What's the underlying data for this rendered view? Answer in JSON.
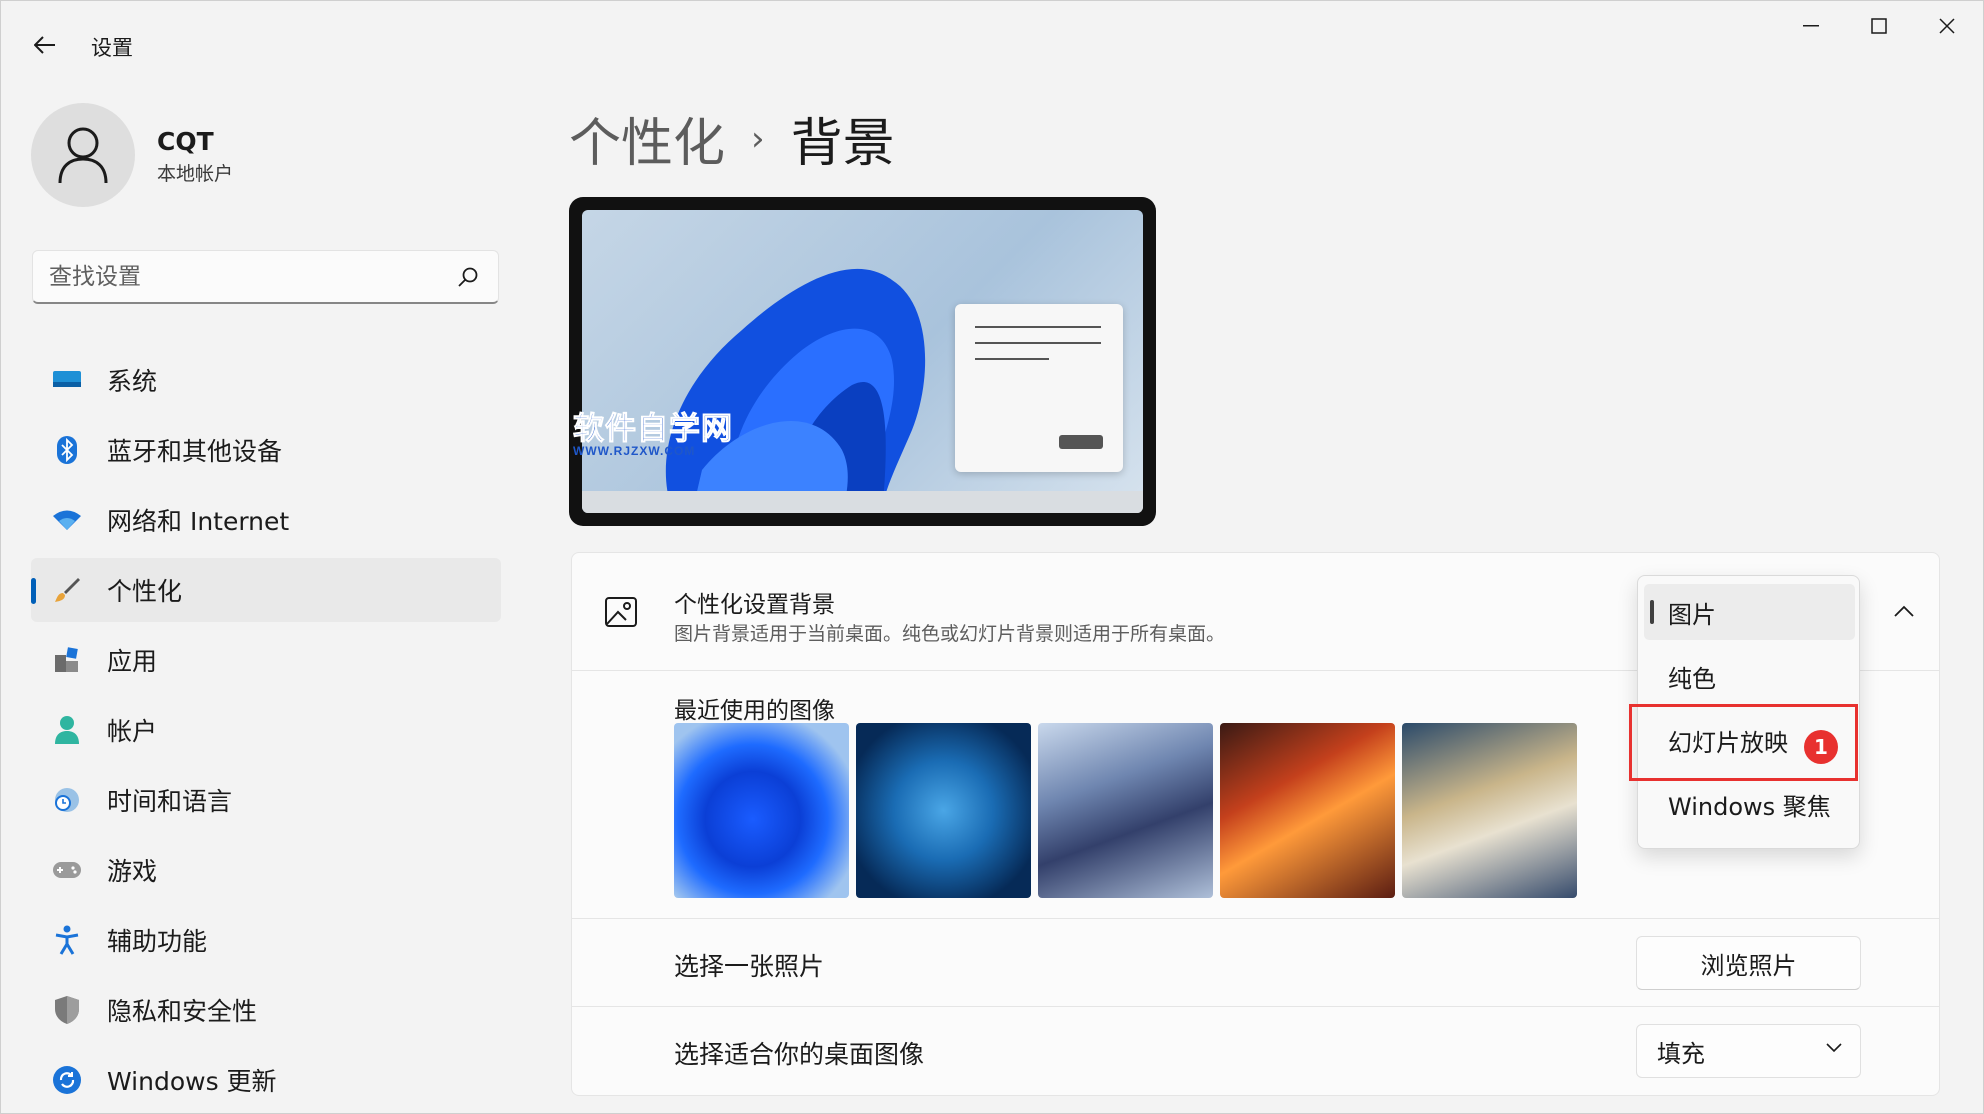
{
  "titlebar": {
    "app_title": "设置",
    "back_icon": "arrow-left-icon"
  },
  "profile": {
    "name": "CQT",
    "subtitle": "本地帐户"
  },
  "search": {
    "placeholder": "查找设置"
  },
  "nav": {
    "items": [
      {
        "label": "系统",
        "icon": "monitor-icon",
        "active": false
      },
      {
        "label": "蓝牙和其他设备",
        "icon": "bluetooth-icon",
        "active": false
      },
      {
        "label": "网络和 Internet",
        "icon": "wifi-icon",
        "active": false
      },
      {
        "label": "个性化",
        "icon": "brush-icon",
        "active": true
      },
      {
        "label": "应用",
        "icon": "apps-icon",
        "active": false
      },
      {
        "label": "帐户",
        "icon": "person-icon",
        "active": false
      },
      {
        "label": "时间和语言",
        "icon": "clock-globe-icon",
        "active": false
      },
      {
        "label": "游戏",
        "icon": "gamepad-icon",
        "active": false
      },
      {
        "label": "辅助功能",
        "icon": "accessibility-icon",
        "active": false
      },
      {
        "label": "隐私和安全性",
        "icon": "shield-icon",
        "active": false
      },
      {
        "label": "Windows 更新",
        "icon": "update-icon",
        "active": false
      }
    ]
  },
  "breadcrumb": {
    "parent": "个性化",
    "separator": "›",
    "current": "背景"
  },
  "preview": {
    "watermark_main": "软件自学网",
    "watermark_sub": "WWW.RJZXW.COM"
  },
  "background_card": {
    "title": "个性化设置背景",
    "description": "图片背景适用于当前桌面。纯色或幻灯片背景则适用于所有桌面。",
    "recent_title": "最近使用的图像",
    "recent_count": 5
  },
  "choose_photo": {
    "label": "选择一张照片",
    "button": "浏览照片"
  },
  "fit": {
    "label": "选择适合你的桌面图像",
    "value": "填充"
  },
  "dropdown": {
    "options": [
      "图片",
      "纯色",
      "幻灯片放映",
      "Windows 聚焦"
    ],
    "selected": "图片",
    "highlighted": "幻灯片放映",
    "badge": "1"
  },
  "colors": {
    "accent": "#005fb8",
    "highlight": "#e8312f"
  }
}
